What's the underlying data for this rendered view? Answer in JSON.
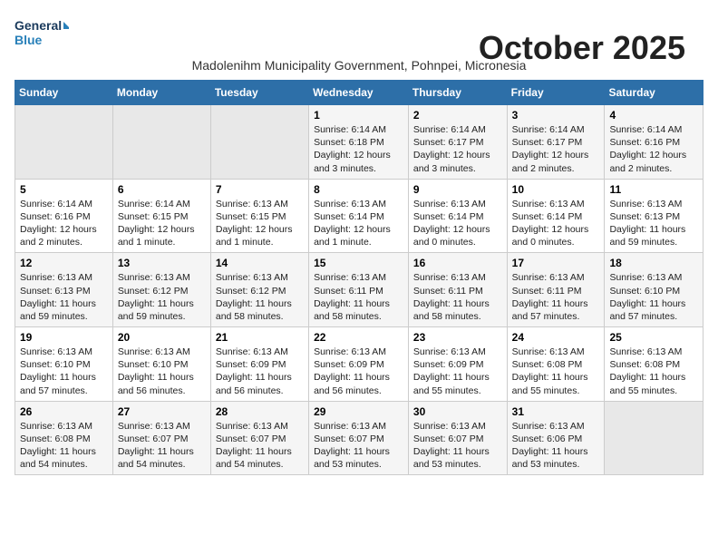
{
  "logo": {
    "line1": "General",
    "line2": "Blue"
  },
  "title": "October 2025",
  "subtitle": "Madolenihm Municipality Government, Pohnpei, Micronesia",
  "days_of_week": [
    "Sunday",
    "Monday",
    "Tuesday",
    "Wednesday",
    "Thursday",
    "Friday",
    "Saturday"
  ],
  "weeks": [
    [
      {
        "day": "",
        "text": ""
      },
      {
        "day": "",
        "text": ""
      },
      {
        "day": "",
        "text": ""
      },
      {
        "day": "1",
        "text": "Sunrise: 6:14 AM\nSunset: 6:18 PM\nDaylight: 12 hours and 3 minutes."
      },
      {
        "day": "2",
        "text": "Sunrise: 6:14 AM\nSunset: 6:17 PM\nDaylight: 12 hours and 3 minutes."
      },
      {
        "day": "3",
        "text": "Sunrise: 6:14 AM\nSunset: 6:17 PM\nDaylight: 12 hours and 2 minutes."
      },
      {
        "day": "4",
        "text": "Sunrise: 6:14 AM\nSunset: 6:16 PM\nDaylight: 12 hours and 2 minutes."
      }
    ],
    [
      {
        "day": "5",
        "text": "Sunrise: 6:14 AM\nSunset: 6:16 PM\nDaylight: 12 hours and 2 minutes."
      },
      {
        "day": "6",
        "text": "Sunrise: 6:14 AM\nSunset: 6:15 PM\nDaylight: 12 hours and 1 minute."
      },
      {
        "day": "7",
        "text": "Sunrise: 6:13 AM\nSunset: 6:15 PM\nDaylight: 12 hours and 1 minute."
      },
      {
        "day": "8",
        "text": "Sunrise: 6:13 AM\nSunset: 6:14 PM\nDaylight: 12 hours and 1 minute."
      },
      {
        "day": "9",
        "text": "Sunrise: 6:13 AM\nSunset: 6:14 PM\nDaylight: 12 hours and 0 minutes."
      },
      {
        "day": "10",
        "text": "Sunrise: 6:13 AM\nSunset: 6:14 PM\nDaylight: 12 hours and 0 minutes."
      },
      {
        "day": "11",
        "text": "Sunrise: 6:13 AM\nSunset: 6:13 PM\nDaylight: 11 hours and 59 minutes."
      }
    ],
    [
      {
        "day": "12",
        "text": "Sunrise: 6:13 AM\nSunset: 6:13 PM\nDaylight: 11 hours and 59 minutes."
      },
      {
        "day": "13",
        "text": "Sunrise: 6:13 AM\nSunset: 6:12 PM\nDaylight: 11 hours and 59 minutes."
      },
      {
        "day": "14",
        "text": "Sunrise: 6:13 AM\nSunset: 6:12 PM\nDaylight: 11 hours and 58 minutes."
      },
      {
        "day": "15",
        "text": "Sunrise: 6:13 AM\nSunset: 6:11 PM\nDaylight: 11 hours and 58 minutes."
      },
      {
        "day": "16",
        "text": "Sunrise: 6:13 AM\nSunset: 6:11 PM\nDaylight: 11 hours and 58 minutes."
      },
      {
        "day": "17",
        "text": "Sunrise: 6:13 AM\nSunset: 6:11 PM\nDaylight: 11 hours and 57 minutes."
      },
      {
        "day": "18",
        "text": "Sunrise: 6:13 AM\nSunset: 6:10 PM\nDaylight: 11 hours and 57 minutes."
      }
    ],
    [
      {
        "day": "19",
        "text": "Sunrise: 6:13 AM\nSunset: 6:10 PM\nDaylight: 11 hours and 57 minutes."
      },
      {
        "day": "20",
        "text": "Sunrise: 6:13 AM\nSunset: 6:10 PM\nDaylight: 11 hours and 56 minutes."
      },
      {
        "day": "21",
        "text": "Sunrise: 6:13 AM\nSunset: 6:09 PM\nDaylight: 11 hours and 56 minutes."
      },
      {
        "day": "22",
        "text": "Sunrise: 6:13 AM\nSunset: 6:09 PM\nDaylight: 11 hours and 56 minutes."
      },
      {
        "day": "23",
        "text": "Sunrise: 6:13 AM\nSunset: 6:09 PM\nDaylight: 11 hours and 55 minutes."
      },
      {
        "day": "24",
        "text": "Sunrise: 6:13 AM\nSunset: 6:08 PM\nDaylight: 11 hours and 55 minutes."
      },
      {
        "day": "25",
        "text": "Sunrise: 6:13 AM\nSunset: 6:08 PM\nDaylight: 11 hours and 55 minutes."
      }
    ],
    [
      {
        "day": "26",
        "text": "Sunrise: 6:13 AM\nSunset: 6:08 PM\nDaylight: 11 hours and 54 minutes."
      },
      {
        "day": "27",
        "text": "Sunrise: 6:13 AM\nSunset: 6:07 PM\nDaylight: 11 hours and 54 minutes."
      },
      {
        "day": "28",
        "text": "Sunrise: 6:13 AM\nSunset: 6:07 PM\nDaylight: 11 hours and 54 minutes."
      },
      {
        "day": "29",
        "text": "Sunrise: 6:13 AM\nSunset: 6:07 PM\nDaylight: 11 hours and 53 minutes."
      },
      {
        "day": "30",
        "text": "Sunrise: 6:13 AM\nSunset: 6:07 PM\nDaylight: 11 hours and 53 minutes."
      },
      {
        "day": "31",
        "text": "Sunrise: 6:13 AM\nSunset: 6:06 PM\nDaylight: 11 hours and 53 minutes."
      },
      {
        "day": "",
        "text": ""
      }
    ]
  ]
}
